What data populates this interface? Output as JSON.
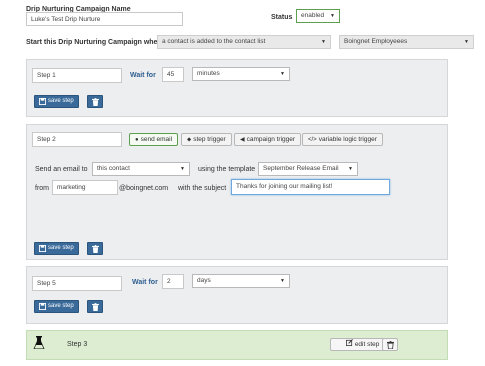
{
  "header": {
    "campaign_name_label": "Drip Nurturing Campaign Name",
    "campaign_name_value": "Luke's Test Drip Nurture",
    "status_label": "Status",
    "status_value": "enabled",
    "start_label": "Start this Drip Nurturing Campaign when",
    "start_trigger": "a contact is added to the contact list",
    "start_list": "Boingnet Employeees"
  },
  "step1": {
    "name": "Step 1",
    "wait_label": "Wait for",
    "wait_value": "45",
    "wait_unit": "minutes",
    "save_label": "save step"
  },
  "step2": {
    "name": "Step 2",
    "actions": {
      "send_email": "send email",
      "step_trigger": "step trigger",
      "campaign_trigger": "campaign trigger",
      "variable_logic_trigger": "variable logic trigger"
    },
    "send_to_label": "Send an email to",
    "send_to_value": "this contact",
    "template_label": "using the template",
    "template_value": "September Release Email",
    "from_label": "from",
    "from_value": "marketing",
    "domain": "@boingnet.com",
    "subject_label": "with the subject",
    "subject_value": "Thanks for joining our mailing list!",
    "save_label": "save step"
  },
  "step5": {
    "name": "Step 5",
    "wait_label": "Wait for",
    "wait_value": "2",
    "wait_unit": "days",
    "save_label": "save step"
  },
  "step3": {
    "name": "Step 3",
    "edit_label": "edit step"
  },
  "colors": {
    "accent": "#3a6a9a",
    "panel": "#eceef0",
    "panel_green": "#dcedd2",
    "status_border": "#5ca04f"
  },
  "icons": [
    "save-icon",
    "trash-icon",
    "chevron-down-icon",
    "email-icon",
    "trigger-icon",
    "bullhorn-icon",
    "code-icon",
    "flask-icon",
    "edit-icon"
  ]
}
